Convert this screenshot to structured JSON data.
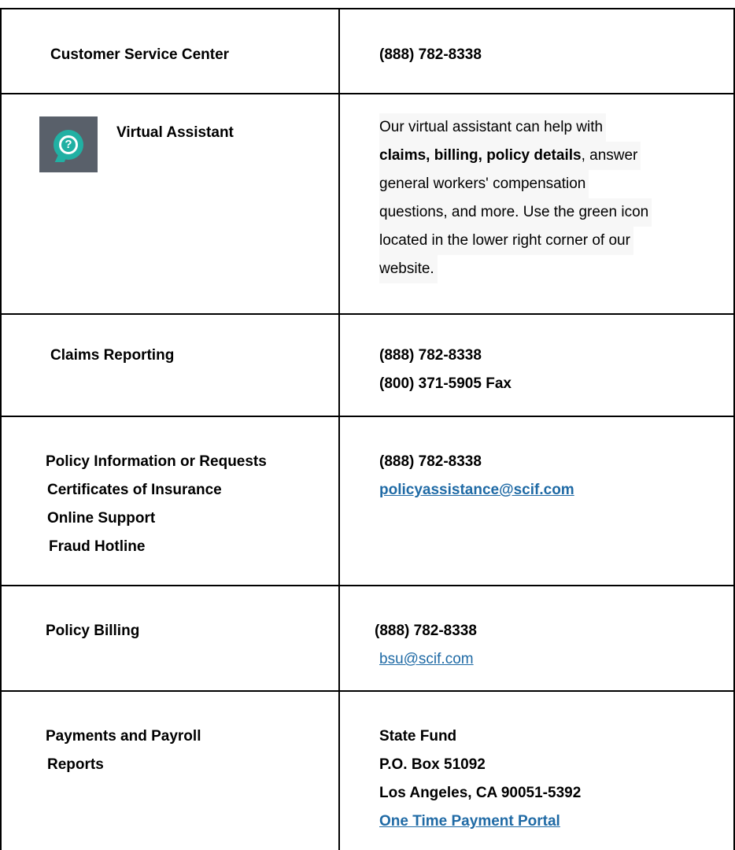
{
  "rows": [
    {
      "label_lines": [
        "Customer Service Center"
      ],
      "value_lines": [
        "(888) 782-8338"
      ]
    },
    {
      "label_lines": [
        "Virtual Assistant"
      ],
      "icon": "chat-question-icon",
      "description": {
        "line1": "Our virtual assistant can help with",
        "line2_bold": "claims, billing, policy details",
        "line2_rest": ", answer",
        "line3": "general workers' compensation",
        "line4": "questions, and more. Use the green icon",
        "line5": "located in the lower right corner of our",
        "line6": "website."
      }
    },
    {
      "label_lines": [
        "Claims Reporting"
      ],
      "value_lines": [
        "(888) 782-8338",
        "(800) 371-5905 Fax"
      ]
    },
    {
      "label_lines": [
        "Policy Information or Requests",
        "Certificates of Insurance",
        "Online Support",
        "Fraud Hotline"
      ],
      "value_phone": "(888) 782-8338",
      "value_email": "policyassistance@scif.com"
    },
    {
      "label_lines": [
        "Policy Billing"
      ],
      "value_phone": "(888) 782-8338",
      "value_email": "bsu@scif.com"
    },
    {
      "label_lines": [
        "Payments and Payroll",
        "Reports"
      ],
      "value_lines": [
        "State Fund",
        "P.O. Box 51092",
        "Los Angeles, CA 90051-5392"
      ],
      "portal_link": "One Time Payment Portal"
    }
  ],
  "colors": {
    "link": "#1f6aa5",
    "icon_bg": "#59606a",
    "icon_bubble": "#21b0a3",
    "border": "#000000"
  }
}
